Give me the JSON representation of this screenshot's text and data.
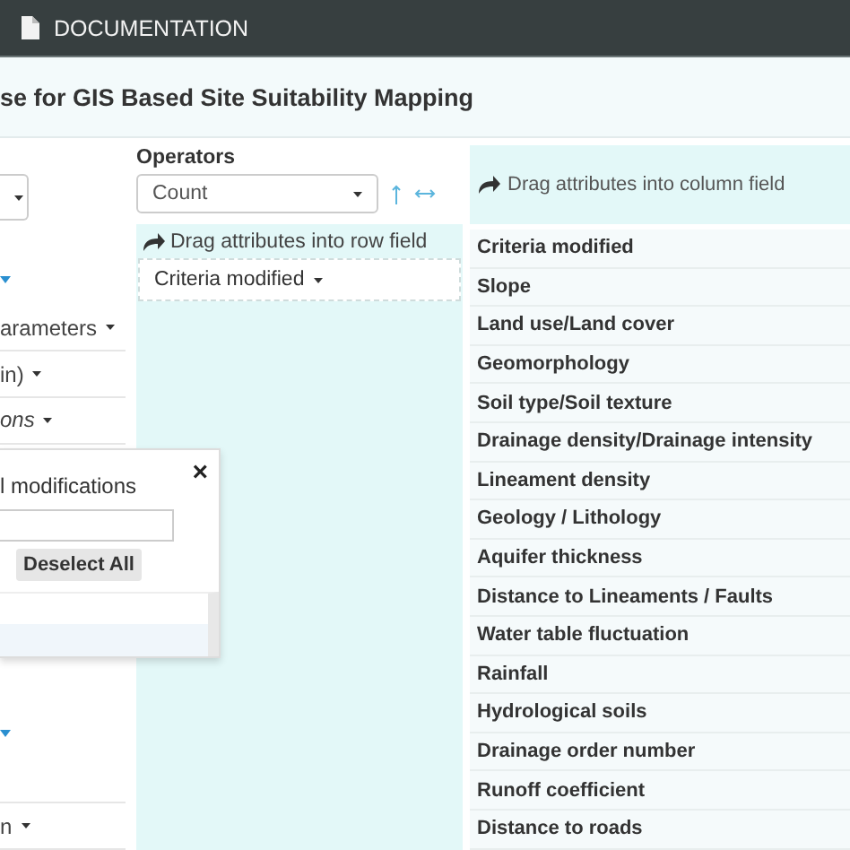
{
  "top_bar": {
    "label": "DOCUMENTATION"
  },
  "title": "se for GIS Based Site Suitability Mapping",
  "left_items": [
    {
      "kind": "select"
    },
    {
      "kind": "caret"
    },
    {
      "kind": "label",
      "label": "arameters",
      "italic": false
    },
    {
      "kind": "label",
      "label": "in)",
      "italic": false
    },
    {
      "kind": "label",
      "label": "ons",
      "italic": true
    }
  ],
  "left_items_below": [
    {
      "kind": "caret"
    },
    {
      "kind": "empty"
    },
    {
      "kind": "label",
      "label": "n",
      "italic": false
    }
  ],
  "popup": {
    "title": "l modifications",
    "close": "×",
    "button": "Deselect All"
  },
  "operators": {
    "label": "Operators",
    "value": "Count"
  },
  "row_zone": {
    "hint": "Drag attributes into row field",
    "fields": [
      "Criteria modified"
    ]
  },
  "column_zone": {
    "hint": "Drag attributes into column field"
  },
  "rows": [
    "Criteria modified",
    "Slope",
    "Land use/Land cover",
    "Geomorphology",
    "Soil type/Soil texture",
    "Drainage density/Drainage intensity",
    "Lineament density",
    "Geology / Lithology",
    "Aquifer thickness",
    "Distance to Lineaments / Faults",
    "Water table fluctuation",
    "Rainfall",
    "Hydrological soils",
    "Drainage order number",
    "Runoff coefficient",
    "Distance to roads"
  ]
}
